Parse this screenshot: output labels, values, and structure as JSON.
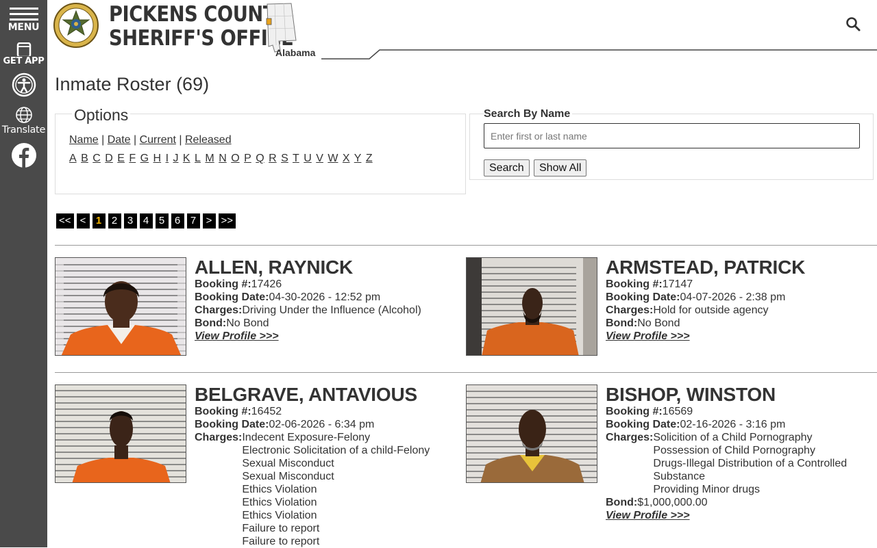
{
  "sidebar": {
    "menu_label": "MENU",
    "app_label": "GET APP",
    "translate_label": "Translate"
  },
  "header": {
    "badge_text": "PICKENS COUNTY",
    "title_line1": "Pickens County",
    "title_line2": "Sheriff's Office",
    "state": "Alabama"
  },
  "page": {
    "title": "Inmate Roster (69)"
  },
  "options": {
    "legend": "Options",
    "links": [
      "Name",
      "Date",
      "Current",
      "Released"
    ],
    "letters": [
      "A",
      "B",
      "C",
      "D",
      "E",
      "F",
      "G",
      "H",
      "I",
      "J",
      "K",
      "L",
      "M",
      "N",
      "O",
      "P",
      "Q",
      "R",
      "S",
      "T",
      "U",
      "V",
      "W",
      "X",
      "Y",
      "Z"
    ]
  },
  "search": {
    "label": "Search By Name",
    "placeholder": "Enter first or last name",
    "value": "",
    "search_button": "Search",
    "show_all_button": "Show All"
  },
  "pagination": {
    "first": "<<",
    "prev": "<",
    "pages": [
      "1",
      "2",
      "3",
      "4",
      "5",
      "6",
      "7"
    ],
    "active": "1",
    "next": ">",
    "last": ">>"
  },
  "labels": {
    "booking_no": "Booking #:",
    "booking_date": "Booking Date:",
    "charges": "Charges:",
    "bond": "Bond:",
    "view_profile": "View Profile >>>"
  },
  "inmates": [
    {
      "name": "ALLEN, RAYNICK",
      "booking_no": "17426",
      "booking_date": "04-30-2026 - 12:52 pm",
      "charges": [
        "Driving Under the Influence (Alcohol)"
      ],
      "bond": "No Bond"
    },
    {
      "name": "ARMSTEAD, PATRICK",
      "booking_no": "17147",
      "booking_date": "04-07-2026 - 2:38 pm",
      "charges": [
        "Hold for outside agency"
      ],
      "bond": "No Bond"
    },
    {
      "name": "BELGRAVE, ANTAVIOUS",
      "booking_no": "16452",
      "booking_date": "02-06-2026 - 6:34 pm",
      "charges": [
        "Indecent Exposure-Felony",
        "Electronic Solicitation of a child-Felony",
        "Sexual Misconduct",
        "Sexual Misconduct",
        "Ethics Violation",
        "Ethics Violation",
        "Ethics Violation",
        "Failure to report",
        "Failure to report"
      ],
      "bond": ""
    },
    {
      "name": "BISHOP, WINSTON",
      "booking_no": "16569",
      "booking_date": "02-16-2026 - 3:16 pm",
      "charges": [
        "Solicition of a Child Pornography",
        "Possession of Child Pornography",
        "Drugs-Illegal Distribution of a Controlled Substance",
        "Providing Minor drugs"
      ],
      "bond": "$1,000,000.00"
    }
  ],
  "colors": {
    "sidebar_bg": "#4a4a4a",
    "active_page": "#f4b400",
    "jumpsuit": "#e8651c"
  }
}
